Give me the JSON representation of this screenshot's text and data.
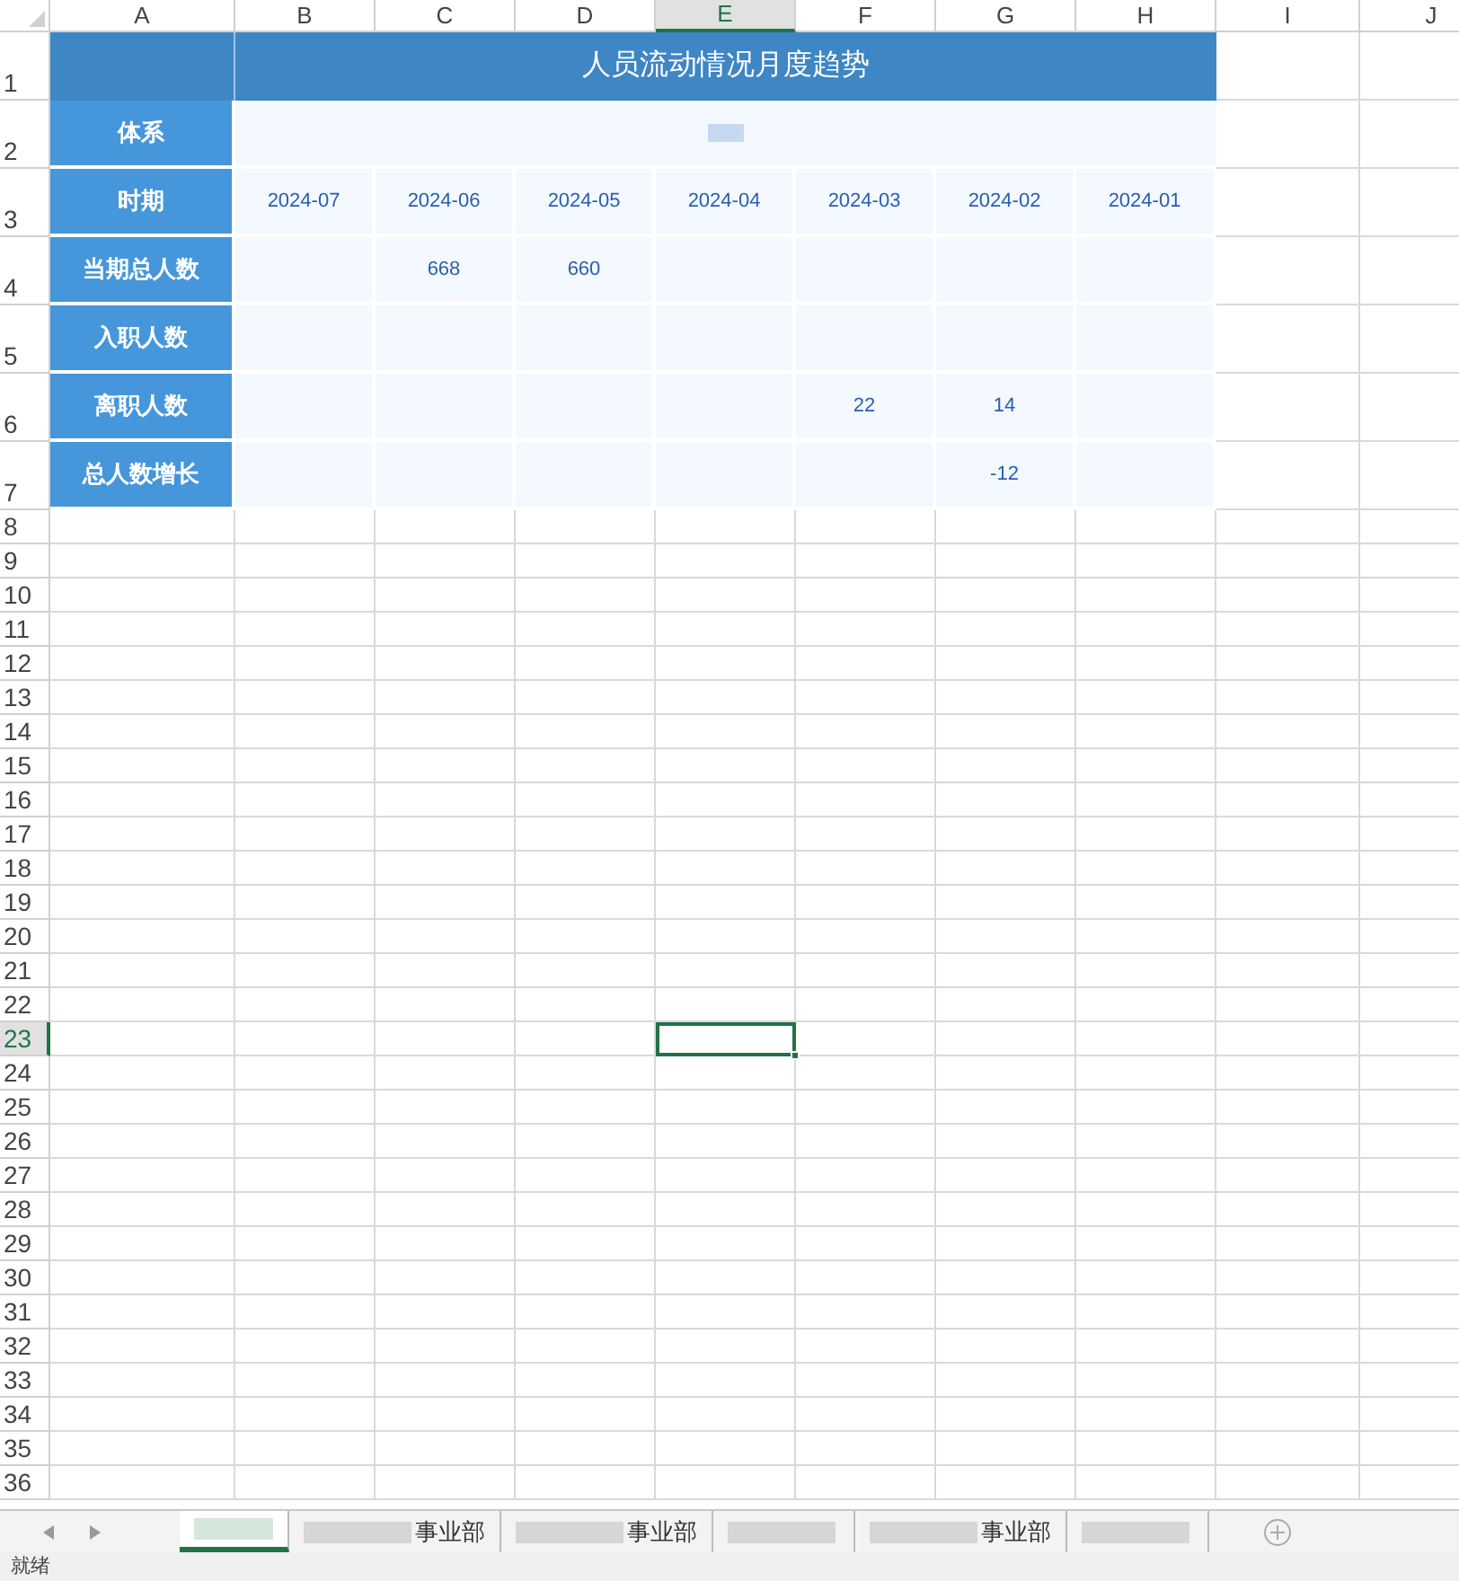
{
  "columns": [
    {
      "label": "A",
      "selected": false
    },
    {
      "label": "B",
      "selected": false
    },
    {
      "label": "C",
      "selected": false
    },
    {
      "label": "D",
      "selected": false
    },
    {
      "label": "E",
      "selected": true
    },
    {
      "label": "F",
      "selected": false
    },
    {
      "label": "G",
      "selected": false
    },
    {
      "label": "H",
      "selected": false
    },
    {
      "label": "I",
      "selected": false
    },
    {
      "label": "J",
      "selected": false
    }
  ],
  "title_row": {
    "number": "1",
    "title": "人员流动情况月度趋势"
  },
  "table_rows": [
    {
      "number": "2",
      "label": "体系",
      "kind": "merged"
    },
    {
      "number": "3",
      "label": "时期",
      "kind": "cells",
      "cells": [
        "2024-07",
        "2024-06",
        "2024-05",
        "2024-04",
        "2024-03",
        "2024-02",
        "2024-01"
      ]
    },
    {
      "number": "4",
      "label": "当期总人数",
      "kind": "cells",
      "cells": [
        null,
        "668",
        "660",
        null,
        null,
        null,
        null
      ]
    },
    {
      "number": "5",
      "label": "入职人数",
      "kind": "cells",
      "cells": [
        null,
        null,
        null,
        null,
        null,
        null,
        null
      ]
    },
    {
      "number": "6",
      "label": "离职人数",
      "kind": "cells",
      "cells": [
        null,
        null,
        null,
        null,
        "22",
        "14",
        null
      ]
    },
    {
      "number": "7",
      "label": "总人数增长",
      "kind": "cells",
      "cells": [
        null,
        null,
        null,
        null,
        null,
        "-12",
        null
      ]
    }
  ],
  "empty_rows": [
    {
      "number": "8",
      "selected": false
    },
    {
      "number": "9",
      "selected": false
    },
    {
      "number": "10",
      "selected": false
    },
    {
      "number": "11",
      "selected": false
    },
    {
      "number": "12",
      "selected": false
    },
    {
      "number": "13",
      "selected": false
    },
    {
      "number": "14",
      "selected": false
    },
    {
      "number": "15",
      "selected": false
    },
    {
      "number": "16",
      "selected": false
    },
    {
      "number": "17",
      "selected": false
    },
    {
      "number": "18",
      "selected": false
    },
    {
      "number": "19",
      "selected": false
    },
    {
      "number": "20",
      "selected": false
    },
    {
      "number": "21",
      "selected": false
    },
    {
      "number": "22",
      "selected": false
    },
    {
      "number": "23",
      "selected": true
    },
    {
      "number": "24",
      "selected": false
    },
    {
      "number": "25",
      "selected": false
    },
    {
      "number": "26",
      "selected": false
    },
    {
      "number": "27",
      "selected": false
    },
    {
      "number": "28",
      "selected": false
    },
    {
      "number": "29",
      "selected": false
    },
    {
      "number": "30",
      "selected": false
    },
    {
      "number": "31",
      "selected": false
    },
    {
      "number": "32",
      "selected": false
    },
    {
      "number": "33",
      "selected": false
    },
    {
      "number": "34",
      "selected": false
    },
    {
      "number": "35",
      "selected": false
    },
    {
      "number": "36",
      "selected": false
    }
  ],
  "sheet_tabs": [
    {
      "selected": true
    },
    {
      "label": "事业部",
      "selected": false
    },
    {
      "label": "事业部",
      "selected": false
    },
    {
      "selected": false
    },
    {
      "label": "事业部",
      "selected": false
    },
    {
      "selected": false
    }
  ],
  "status_bar": "就绪"
}
